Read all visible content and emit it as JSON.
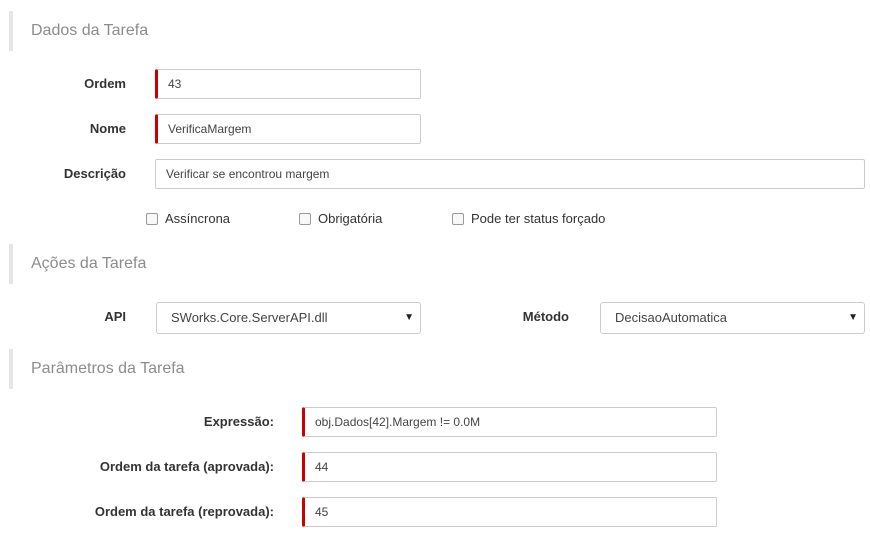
{
  "sections": {
    "dados": "Dados da Tarefa",
    "acoes": "Ações da Tarefa",
    "parametros": "Parâmetros da Tarefa"
  },
  "dados": {
    "ordem_label": "Ordem",
    "ordem_value": "43",
    "nome_label": "Nome",
    "nome_value": "VerificaMargem",
    "descricao_label": "Descrição",
    "descricao_value": "Verificar se encontrou margem",
    "checkboxes": [
      {
        "label": "Assíncrona",
        "checked": false
      },
      {
        "label": "Obrigatória",
        "checked": false
      },
      {
        "label": "Pode ter status forçado",
        "checked": false
      }
    ]
  },
  "acoes": {
    "api_label": "API",
    "api_value": "SWorks.Core.ServerAPI.dll",
    "metodo_label": "Método",
    "metodo_value": "DecisaoAutomatica"
  },
  "parametros": {
    "expressao_label": "Expressão:",
    "expressao_value": "obj.Dados[42].Margem != 0.0M",
    "aprovada_label": "Ordem da tarefa (aprovada):",
    "aprovada_value": "44",
    "reprovada_label": "Ordem da tarefa (reprovada):",
    "reprovada_value": "45"
  },
  "colors": {
    "required_marker": "#cc0000",
    "section_text": "#8c8c8c"
  },
  "icons": {
    "select_caret": "caret-down-icon",
    "checkbox": "checkbox-icon"
  }
}
